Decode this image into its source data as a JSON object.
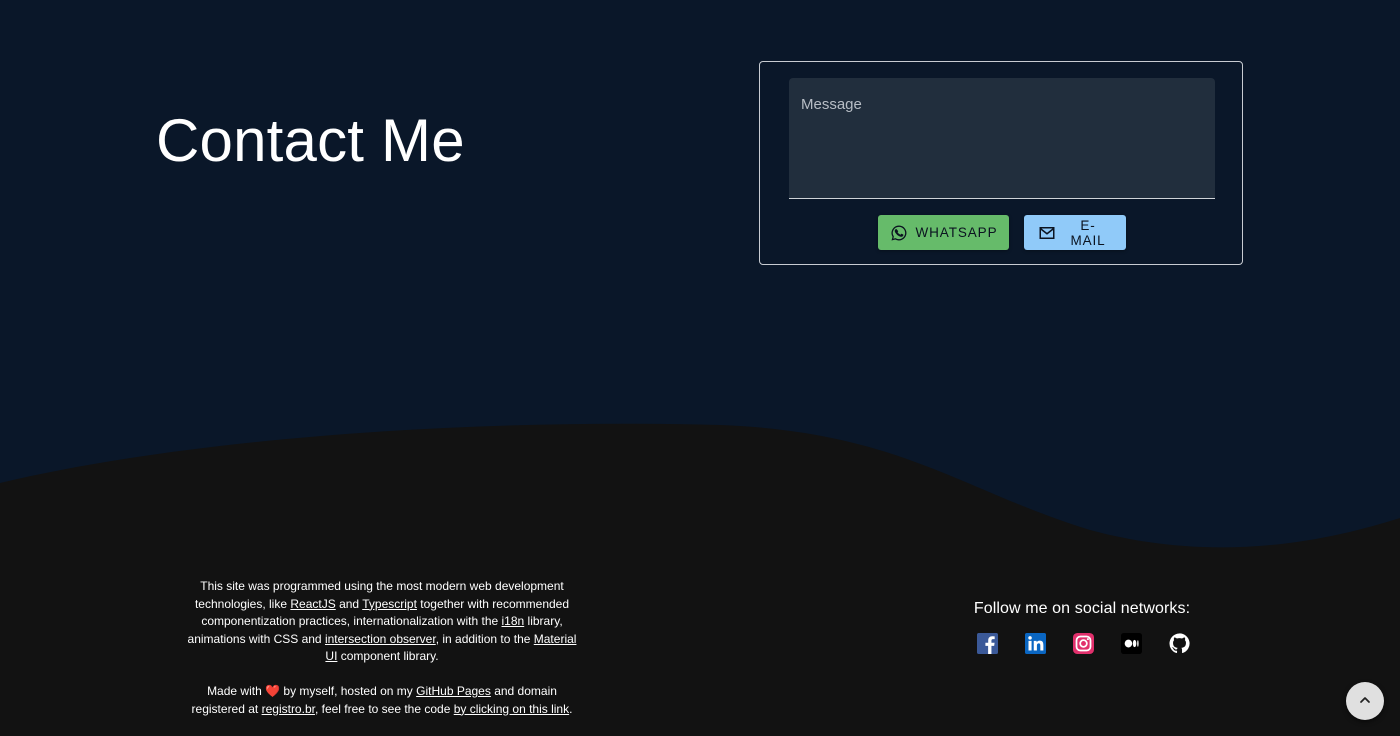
{
  "contact": {
    "title": "Contact Me",
    "message_placeholder": "Message",
    "whatsapp_label": "WHATSAPP",
    "email_label": "E-MAIL"
  },
  "footer": {
    "about": {
      "t1": "This site was programmed using the most modern web development technologies, like",
      "reactjs": "ReactJS",
      "t2": "and",
      "typescript": "Typescript",
      "t3": "together with recommended componentization practices, internationalization with the",
      "i18n": "i18n",
      "t4": "library, animations with CSS and",
      "intersection_observer": "intersection observer",
      "t5": ", in addition to the",
      "material_ui": "Material UI",
      "t6": "component library."
    },
    "made": {
      "t1": "Made with",
      "heart": "❤️",
      "t2": "by myself, hosted on my",
      "github_pages": "GitHub Pages",
      "t3": "and domain registered at",
      "registro": "registro.br",
      "t4": ", feel free to see the code",
      "link": "by clicking on this link",
      "t5": "."
    }
  },
  "social": {
    "title": "Follow me on social networks:",
    "networks": [
      "facebook-icon",
      "linkedin-icon",
      "instagram-icon",
      "medium-icon",
      "github-icon"
    ]
  },
  "colors": {
    "background": "#0a1729",
    "footer": "#121212",
    "whatsapp": "#66bb6a",
    "email": "#90caf9",
    "message_field": "#212e3d"
  }
}
